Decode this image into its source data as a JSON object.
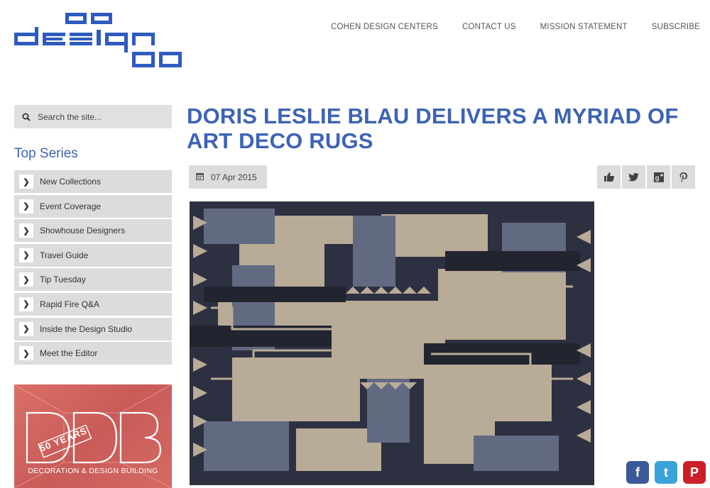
{
  "logo": {
    "text": "go design go",
    "color": "#2e5bbf"
  },
  "topnav": [
    "COHEN DESIGN CENTERS",
    "CONTACT US",
    "MISSION STATEMENT",
    "SUBSCRIBE"
  ],
  "search": {
    "placeholder": "Search the site..."
  },
  "sidebar": {
    "title": "Top Series",
    "items": [
      "New Collections",
      "Event Coverage",
      "Showhouse Designers",
      "Travel Guide",
      "Tip Tuesday",
      "Rapid Fire Q&A",
      "Inside the Design Studio",
      "Meet the Editor"
    ]
  },
  "ad": {
    "years": "50 YEARS",
    "caption": "DECORATION & DESIGN BUILDING"
  },
  "article": {
    "title": "DORIS LESLIE BLAU DELIVERS A MYRIAD OF ART DECO RUGS",
    "date": "07 Apr 2015"
  },
  "share_icons": [
    "thumbs-up-icon",
    "twitter-icon",
    "google-plus-icon",
    "pinterest-icon"
  ],
  "floating_social": [
    "facebook-icon",
    "twitter-icon",
    "pinterest-icon"
  ],
  "colors": {
    "accent": "#3d63b5",
    "chip": "#dcdcdc"
  }
}
